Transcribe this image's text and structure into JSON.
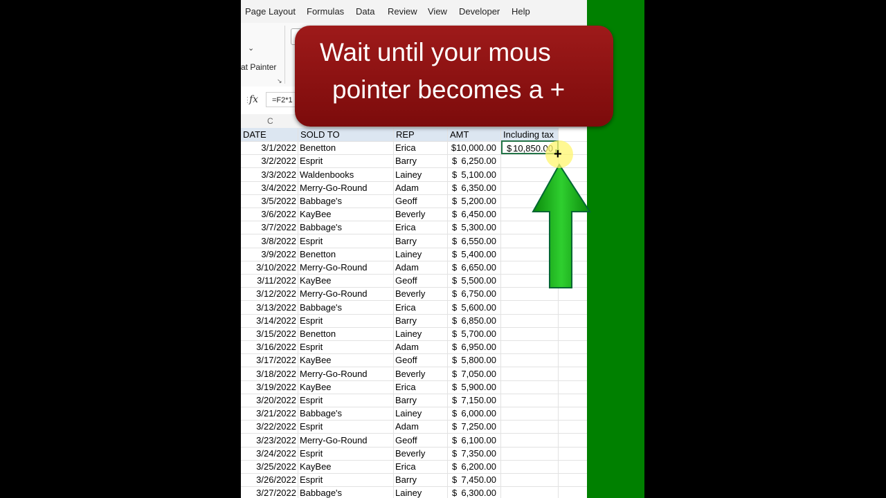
{
  "menu": [
    "Page Layout",
    "Formulas",
    "Data",
    "Review",
    "View",
    "Developer",
    "Help"
  ],
  "ribbon": {
    "painter_label": "at Painter",
    "chevron": "⌄",
    "launcher": "↘"
  },
  "formula_bar": {
    "fx": "fx",
    "value": "=F2*1"
  },
  "column_letter": "C",
  "table": {
    "headers": {
      "date": "DATE",
      "sold_to": "SOLD TO",
      "rep": "REP",
      "amt": "AMT",
      "including_tax": "Including tax"
    },
    "rows": [
      {
        "date": "3/1/2022",
        "sold_to": "Benetton",
        "rep": "Erica",
        "amt": "$10,000.00"
      },
      {
        "date": "3/2/2022",
        "sold_to": "Esprit",
        "rep": "Barry",
        "amt": "6,250.00"
      },
      {
        "date": "3/3/2022",
        "sold_to": "Waldenbooks",
        "rep": "Lainey",
        "amt": "5,100.00"
      },
      {
        "date": "3/4/2022",
        "sold_to": "Merry-Go-Round",
        "rep": "Adam",
        "amt": "6,350.00"
      },
      {
        "date": "3/5/2022",
        "sold_to": "Babbage's",
        "rep": "Geoff",
        "amt": "5,200.00"
      },
      {
        "date": "3/6/2022",
        "sold_to": "KayBee",
        "rep": "Beverly",
        "amt": "6,450.00"
      },
      {
        "date": "3/7/2022",
        "sold_to": "Babbage's",
        "rep": "Erica",
        "amt": "5,300.00"
      },
      {
        "date": "3/8/2022",
        "sold_to": "Esprit",
        "rep": "Barry",
        "amt": "6,550.00"
      },
      {
        "date": "3/9/2022",
        "sold_to": "Benetton",
        "rep": "Lainey",
        "amt": "5,400.00"
      },
      {
        "date": "3/10/2022",
        "sold_to": "Merry-Go-Round",
        "rep": "Adam",
        "amt": "6,650.00"
      },
      {
        "date": "3/11/2022",
        "sold_to": "KayBee",
        "rep": "Geoff",
        "amt": "5,500.00"
      },
      {
        "date": "3/12/2022",
        "sold_to": "Merry-Go-Round",
        "rep": "Beverly",
        "amt": "6,750.00"
      },
      {
        "date": "3/13/2022",
        "sold_to": "Babbage's",
        "rep": "Erica",
        "amt": "5,600.00"
      },
      {
        "date": "3/14/2022",
        "sold_to": "Esprit",
        "rep": "Barry",
        "amt": "6,850.00"
      },
      {
        "date": "3/15/2022",
        "sold_to": "Benetton",
        "rep": "Lainey",
        "amt": "5,700.00"
      },
      {
        "date": "3/16/2022",
        "sold_to": "Esprit",
        "rep": "Adam",
        "amt": "6,950.00"
      },
      {
        "date": "3/17/2022",
        "sold_to": "KayBee",
        "rep": "Geoff",
        "amt": "5,800.00"
      },
      {
        "date": "3/18/2022",
        "sold_to": "Merry-Go-Round",
        "rep": "Beverly",
        "amt": "7,050.00"
      },
      {
        "date": "3/19/2022",
        "sold_to": "KayBee",
        "rep": "Erica",
        "amt": "5,900.00"
      },
      {
        "date": "3/20/2022",
        "sold_to": "Esprit",
        "rep": "Barry",
        "amt": "7,150.00"
      },
      {
        "date": "3/21/2022",
        "sold_to": "Babbage's",
        "rep": "Lainey",
        "amt": "6,000.00"
      },
      {
        "date": "3/22/2022",
        "sold_to": "Esprit",
        "rep": "Adam",
        "amt": "7,250.00"
      },
      {
        "date": "3/23/2022",
        "sold_to": "Merry-Go-Round",
        "rep": "Geoff",
        "amt": "6,100.00"
      },
      {
        "date": "3/24/2022",
        "sold_to": "Esprit",
        "rep": "Beverly",
        "amt": "7,350.00"
      },
      {
        "date": "3/25/2022",
        "sold_to": "KayBee",
        "rep": "Erica",
        "amt": "6,200.00"
      },
      {
        "date": "3/26/2022",
        "sold_to": "Esprit",
        "rep": "Barry",
        "amt": "7,450.00"
      },
      {
        "date": "3/27/2022",
        "sold_to": "Babbage's",
        "rep": "Lainey",
        "amt": "6,300.00"
      }
    ],
    "currency_symbol": "$",
    "selected_cell_value": "10,850.00"
  },
  "callout": {
    "line1": "Wait until your mous",
    "line2": "pointer becomes a +"
  },
  "cursor_glyph": "+",
  "colors": {
    "callout": "#8b1010",
    "arrow": "#1aa31a",
    "side_bar": "#008000",
    "selection": "#217346"
  }
}
